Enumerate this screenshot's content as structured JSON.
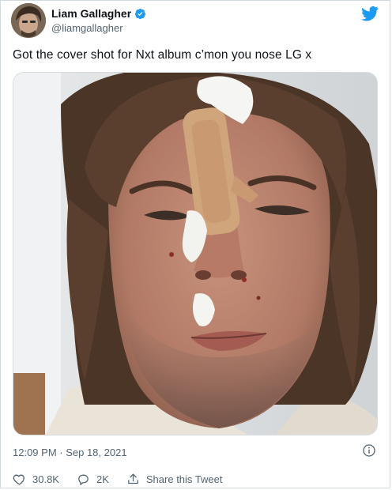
{
  "author": {
    "name": "Liam Gallagher",
    "handle": "@liamgallagher"
  },
  "tweet": {
    "text": "Got the cover shot for Nxt album c’mon you nose LG x",
    "timestamp": "12:09 PM · Sep 18, 2021"
  },
  "actions": {
    "like_count": "30.8K",
    "reply_count": "2K",
    "share_label": "Share this Tweet"
  },
  "icons": {
    "brand": "twitter-bird-icon",
    "verified": "verified-badge-icon",
    "info": "info-icon",
    "like": "heart-icon",
    "reply": "reply-bubble-icon",
    "share": "share-icon"
  },
  "colors": {
    "accent": "#1d9bf0",
    "text_primary": "#0f1419",
    "text_secondary": "#536471",
    "border": "#cfd9de"
  }
}
